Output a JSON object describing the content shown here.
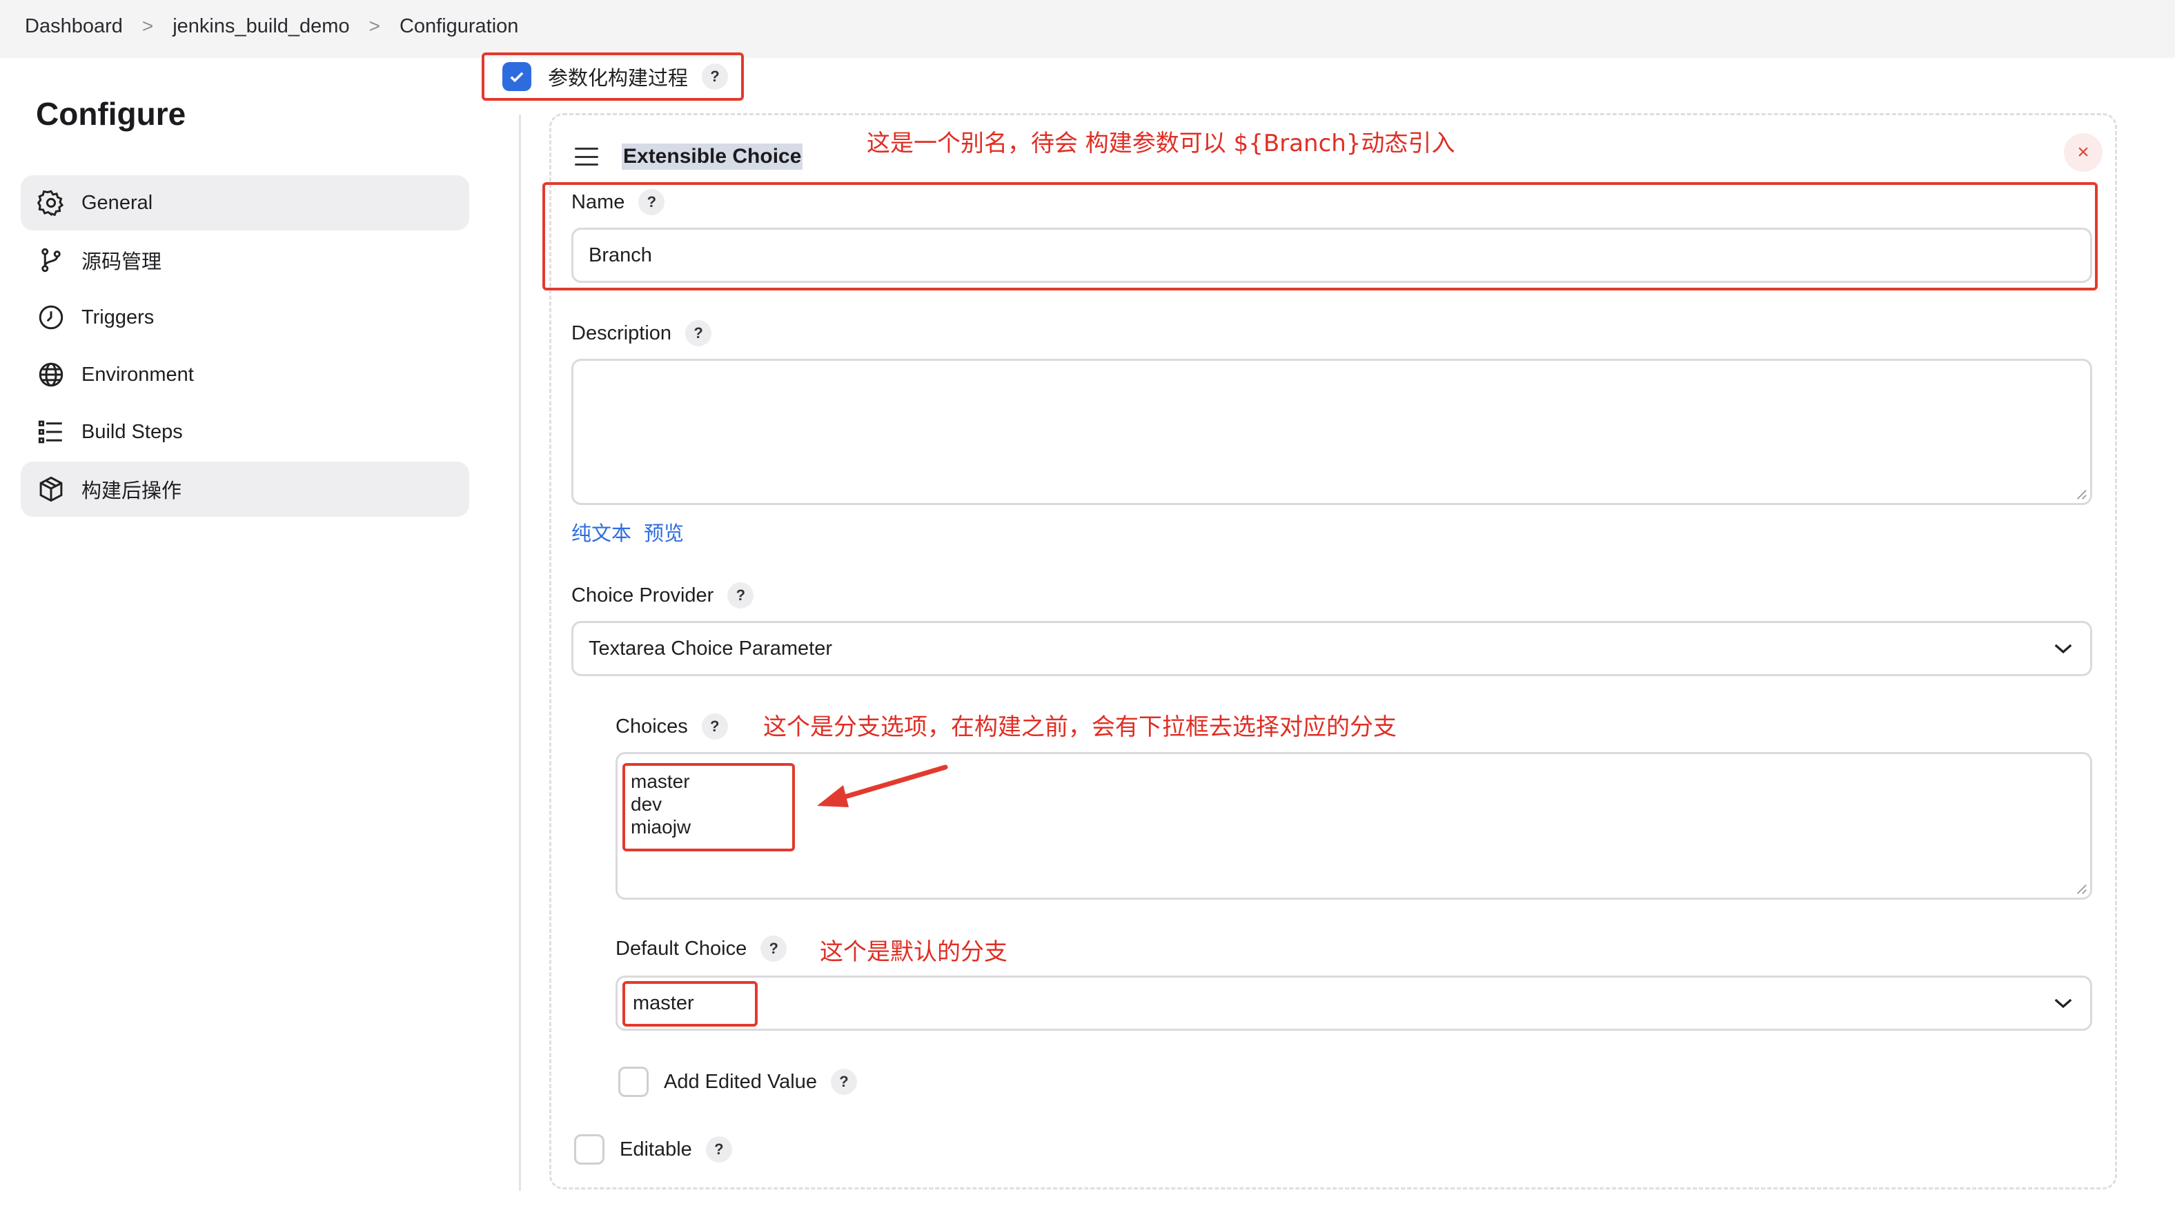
{
  "breadcrumb": {
    "items": [
      "Dashboard",
      "jenkins_build_demo",
      "Configuration"
    ],
    "separator": ">"
  },
  "sidebar": {
    "title": "Configure",
    "items": [
      {
        "label": "General",
        "icon": "gear-icon",
        "active": true
      },
      {
        "label": "源码管理",
        "icon": "branch-icon",
        "active": false
      },
      {
        "label": "Triggers",
        "icon": "clock-icon",
        "active": false
      },
      {
        "label": "Environment",
        "icon": "globe-icon",
        "active": false
      },
      {
        "label": "Build Steps",
        "icon": "list-icon",
        "active": false
      },
      {
        "label": "构建后操作",
        "icon": "package-icon",
        "active": true
      }
    ]
  },
  "param_toggle": {
    "label": "参数化构建过程",
    "checked": true,
    "help": "?"
  },
  "card": {
    "title": "Extensible Choice",
    "close": "×",
    "name_label": "Name",
    "name_value": "Branch",
    "description_label": "Description",
    "description_value": "",
    "format_links": [
      "纯文本",
      "预览"
    ],
    "provider_label": "Choice Provider",
    "provider_value": "Textarea Choice Parameter",
    "choices_label": "Choices",
    "choices_value": "master\ndev\nmiaojw",
    "default_label": "Default Choice",
    "default_value": "master",
    "add_edited_label": "Add Edited Value",
    "editable_label": "Editable",
    "help": "?"
  },
  "annotations": {
    "name_note": "这是一个别名，待会 构建参数可以 ${Branch}动态引入",
    "choices_note": "这个是分支选项，在构建之前，会有下拉框去选择对应的分支",
    "default_note": "这个是默认的分支"
  },
  "colors": {
    "accent": "#2d6cdf",
    "annotation": "#e02e24",
    "close": "#d8483b"
  }
}
